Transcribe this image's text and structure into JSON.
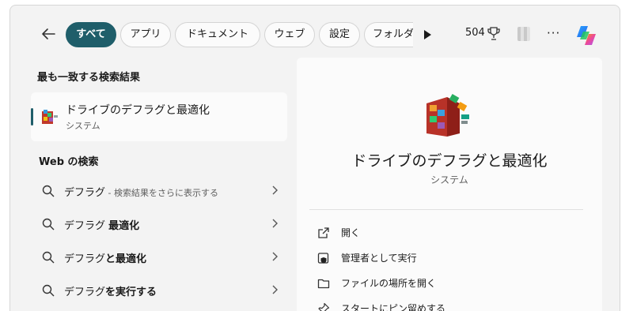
{
  "topbar": {
    "filters": [
      {
        "label": "すべて",
        "active": true
      },
      {
        "label": "アプリ",
        "active": false
      },
      {
        "label": "ドキュメント",
        "active": false
      },
      {
        "label": "ウェブ",
        "active": false
      },
      {
        "label": "設定",
        "active": false
      },
      {
        "label": "フォルダー",
        "active": false
      }
    ],
    "points": "504"
  },
  "best_match": {
    "heading": "最も一致する検索結果",
    "title": "ドライブのデフラグと最適化",
    "subtitle": "システム"
  },
  "web": {
    "heading": "Web の検索",
    "items": [
      {
        "prefix": "デフラグ",
        "bold": "",
        "suffix": " - 検索結果をさらに表示する"
      },
      {
        "prefix": "デフラグ ",
        "bold": "最適化",
        "suffix": ""
      },
      {
        "prefix": "デフラグ",
        "bold": "と最適化",
        "suffix": ""
      },
      {
        "prefix": "デフラグ",
        "bold": "を実行する",
        "suffix": ""
      }
    ]
  },
  "detail": {
    "title": "ドライブのデフラグと最適化",
    "subtitle": "システム",
    "actions": [
      {
        "label": "開く",
        "icon": "open-icon"
      },
      {
        "label": "管理者として実行",
        "icon": "shield-icon"
      },
      {
        "label": "ファイルの場所を開く",
        "icon": "folder-icon"
      },
      {
        "label": "スタートにピン留めする",
        "icon": "pin-icon"
      }
    ]
  },
  "colors": {
    "accent": "#1f5e6a",
    "panel": "#f3f3f3",
    "card": "#fbfbfb"
  }
}
